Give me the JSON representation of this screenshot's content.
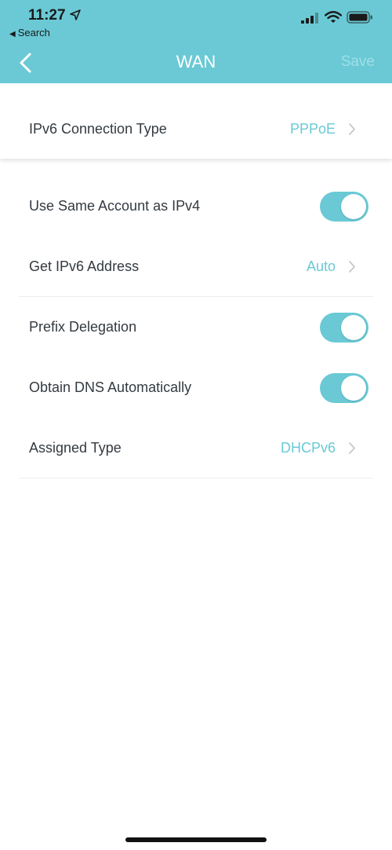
{
  "status_bar": {
    "time": "11:27",
    "back_app": "Search"
  },
  "header": {
    "title": "WAN",
    "save_label": "Save"
  },
  "connection": {
    "label": "IPv6 Connection Type",
    "value": "PPPoE"
  },
  "settings": {
    "same_account": {
      "label": "Use Same Account as IPv4",
      "enabled": true
    },
    "get_address": {
      "label": "Get IPv6 Address",
      "value": "Auto"
    },
    "prefix_delegation": {
      "label": "Prefix Delegation",
      "enabled": true
    },
    "obtain_dns": {
      "label": "Obtain DNS Automatically",
      "enabled": true
    },
    "assigned_type": {
      "label": "Assigned Type",
      "value": "DHCPv6"
    }
  },
  "colors": {
    "accent": "#6ac9d5",
    "text": "#333a40"
  }
}
